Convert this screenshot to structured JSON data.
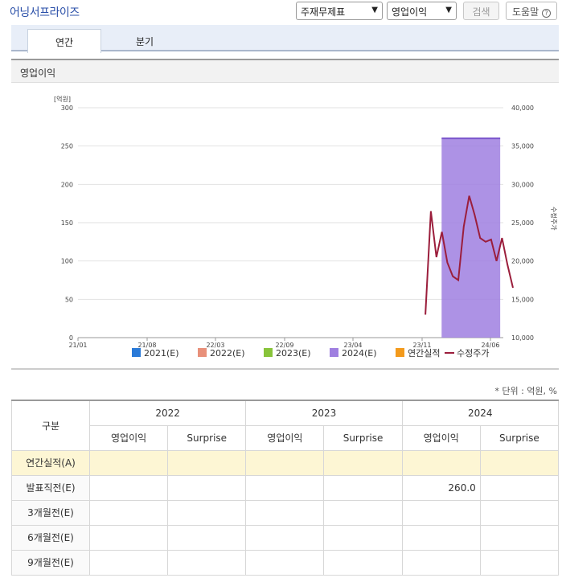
{
  "header": {
    "title": "어닝서프라이즈",
    "select1": "주재무제표",
    "select2": "영업이익",
    "search_label": "검색",
    "help_label": "도움말"
  },
  "tabs": [
    {
      "label": "연간",
      "active": true
    },
    {
      "label": "분기",
      "active": false
    }
  ],
  "section_title": "영업이익",
  "chart_data": {
    "type": "bar",
    "title": "",
    "ylabel": "[억원]",
    "y2label": "수정주가",
    "ylim": [
      0,
      300
    ],
    "y2lim": [
      10000,
      40000
    ],
    "yticks": [
      "0",
      "50",
      "100",
      "150",
      "200",
      "250",
      "300"
    ],
    "y2ticks": [
      "10,000",
      "15,000",
      "20,000",
      "25,000",
      "30,000",
      "35,000",
      "40,000"
    ],
    "xticks": [
      "21/01",
      "21/08",
      "22/03",
      "22/09",
      "23/04",
      "23/11",
      "24/06"
    ],
    "series": [
      {
        "name": "2021(E)",
        "color": "#2a7ad8",
        "values": []
      },
      {
        "name": "2022(E)",
        "color": "#e8907a",
        "values": []
      },
      {
        "name": "2023(E)",
        "color": "#88c43a",
        "values": []
      },
      {
        "name": "2024(E)",
        "color": "#9f7fe0",
        "values": [
          {
            "x_start": "24/01",
            "x_end": "24/07",
            "y": 260
          }
        ]
      },
      {
        "name": "연간실적",
        "color": "#f39a1c",
        "values": []
      },
      {
        "name": "수정주가",
        "color": "#9b1e3c",
        "type": "line",
        "points": [
          [
            "23/12",
            13000
          ],
          [
            "23/12",
            26500
          ],
          [
            "24/01",
            20500
          ],
          [
            "24/01",
            23800
          ],
          [
            "24/01",
            19800
          ],
          [
            "24/02",
            18000
          ],
          [
            "24/02",
            17500
          ],
          [
            "24/02",
            24500
          ],
          [
            "24/03",
            28500
          ],
          [
            "24/03",
            26000
          ],
          [
            "24/04",
            23000
          ],
          [
            "24/04",
            22500
          ],
          [
            "24/05",
            22800
          ],
          [
            "24/05",
            20000
          ],
          [
            "24/05",
            23000
          ],
          [
            "24/06",
            19500
          ],
          [
            "24/06",
            16500
          ]
        ]
      }
    ],
    "legend_position": "bottom",
    "grid": true
  },
  "unit_note": "* 단위 : 억원, %",
  "table": {
    "col_header": "구분",
    "years": [
      "2022",
      "2023",
      "2024"
    ],
    "sub_headers": [
      "영업이익",
      "Surprise"
    ],
    "rows": [
      {
        "label": "연간실적(A)",
        "cells": [
          "",
          "",
          "",
          "",
          "",
          ""
        ]
      },
      {
        "label": "발표직전(E)",
        "cells": [
          "",
          "",
          "",
          "",
          "260.0",
          ""
        ]
      },
      {
        "label": "3개월전(E)",
        "cells": [
          "",
          "",
          "",
          "",
          "",
          ""
        ]
      },
      {
        "label": "6개월전(E)",
        "cells": [
          "",
          "",
          "",
          "",
          "",
          ""
        ]
      },
      {
        "label": "9개월전(E)",
        "cells": [
          "",
          "",
          "",
          "",
          "",
          ""
        ]
      }
    ]
  }
}
